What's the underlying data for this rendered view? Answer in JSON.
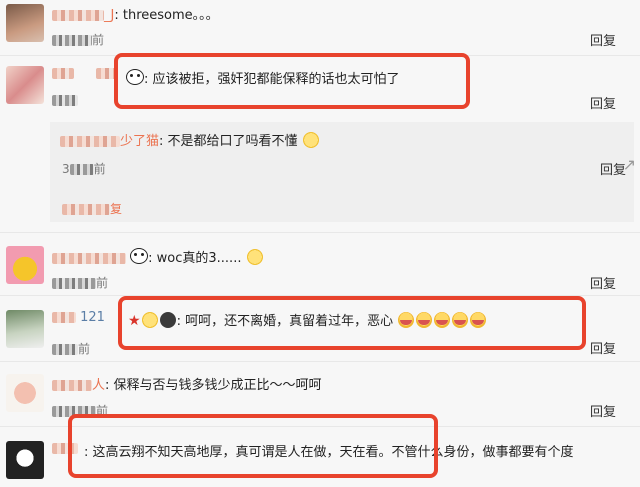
{
  "comments": [
    {
      "user_suffix": "_J",
      "text": "threesome。。。",
      "time_suffix": "前",
      "reply": "回复"
    },
    {
      "user_suffix": "",
      "text": "应该被拒，强奸犯都能保释的话也太可怕了",
      "time_suffix": "",
      "reply": "回复"
    },
    {
      "user_suffix": "少了猫",
      "text": "不是都给口了吗看不懂",
      "time_prefix": "3",
      "time_suffix": "前",
      "reply": "回复",
      "more": "复"
    },
    {
      "user_suffix": "",
      "text": "woc真的3......",
      "time_suffix": "前",
      "reply": "回复"
    },
    {
      "user_suffix": "121",
      "text": "呵呵，还不离婚，真留着过年，恶心",
      "time_suffix": "前",
      "reply": "回复"
    },
    {
      "user_suffix": "人",
      "text": "保释与否与钱多钱少成正比～～呵呵",
      "time_suffix": "前",
      "reply": "回复"
    },
    {
      "user_suffix": "",
      "text": "这高云翔不知天高地厚，真可谓是人在做，天在看。不管什么身份，做事都要有个度",
      "time_suffix": "",
      "reply": "回复"
    }
  ],
  "colors": {
    "username": "#eb7350",
    "highlight": "#e8432d",
    "background": "#f7f7f7"
  },
  "icons": {
    "panda": "panda-icon",
    "crying": "crying-emoji-icon",
    "smile": "smile-emoji-icon",
    "trend": "trend-icon"
  }
}
